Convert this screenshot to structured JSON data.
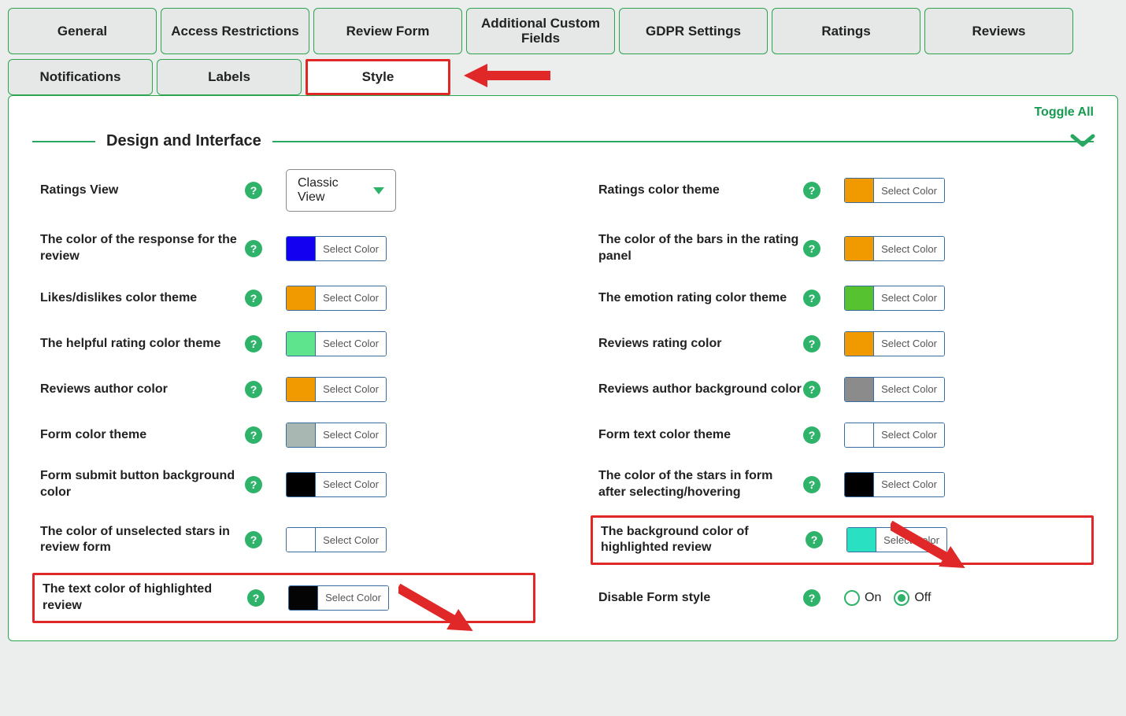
{
  "tabs_row1": [
    "General",
    "Access Restrictions",
    "Review Form",
    "Additional Custom Fields",
    "GDPR Settings",
    "Ratings",
    "Reviews"
  ],
  "tabs_row2": [
    "Notifications",
    "Labels",
    "Style"
  ],
  "toggle_all": "Toggle All",
  "section_title": "Design and Interface",
  "select_color": "Select Color",
  "dropdown_value": "Classic View",
  "left": [
    {
      "label": "Ratings View",
      "type": "dropdown"
    },
    {
      "label": "The color of the response for the review",
      "swatch": "#1300f0"
    },
    {
      "label": "Likes/dislikes color theme",
      "swatch": "#f09a00"
    },
    {
      "label": "The helpful rating color theme",
      "swatch": "#5ee48d"
    },
    {
      "label": "Reviews author color",
      "swatch": "#f09a00"
    },
    {
      "label": "Form color theme",
      "swatch": "#a9b7b3"
    },
    {
      "label": "Form submit button background color",
      "swatch": "#000000"
    },
    {
      "label": "The color of unselected stars in review form",
      "swatch": "#ffffff"
    },
    {
      "label": "The text color of highlighted review",
      "swatch": "#040404",
      "callout": true
    }
  ],
  "right": [
    {
      "label": "Ratings color theme",
      "swatch": "#f09a00"
    },
    {
      "label": "The color of the bars in the rating panel",
      "swatch": "#f09a00"
    },
    {
      "label": "The emotion rating color theme",
      "swatch": "#57c22f"
    },
    {
      "label": "Reviews rating color",
      "swatch": "#f09a00"
    },
    {
      "label": "Reviews author background color",
      "swatch": "#8b8b8b"
    },
    {
      "label": "Form text color theme",
      "swatch": "#ffffff"
    },
    {
      "label": "The color of the stars in form after selecting/hovering",
      "swatch": "#000000"
    },
    {
      "label": "The background color of highlighted review",
      "swatch": "#29e0c3",
      "callout": true
    },
    {
      "label": "Disable Form style",
      "type": "radio"
    }
  ],
  "radio": {
    "on": "On",
    "off": "Off",
    "value": "Off"
  }
}
